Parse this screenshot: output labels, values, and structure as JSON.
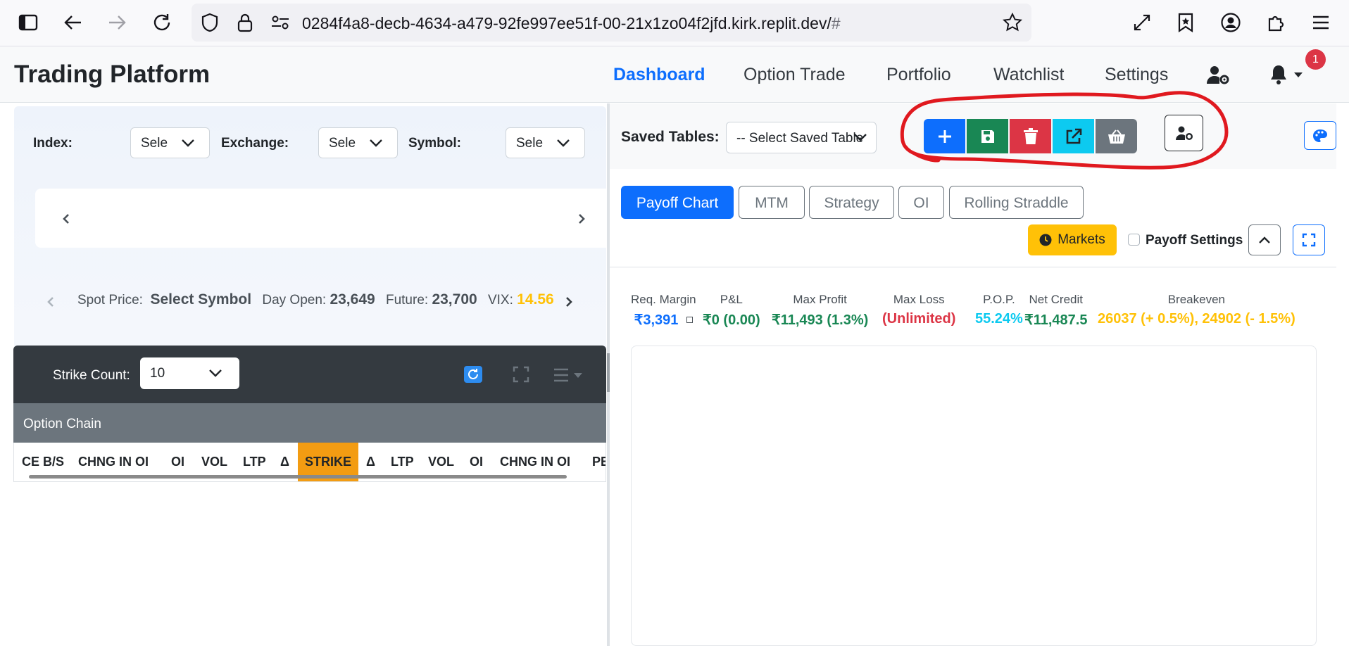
{
  "browser": {
    "url_main": "0284f4a8-decb-4634-a479-92fe997ee51f-00-21x1zo04f2jfd.kirk.replit.dev/",
    "url_hash": "#"
  },
  "navbar": {
    "brand": "Trading Platform",
    "links": [
      {
        "label": "Dashboard",
        "active": true
      },
      {
        "label": "Option Trade"
      },
      {
        "label": "Portfolio"
      },
      {
        "label": "Watchlist"
      },
      {
        "label": "Settings"
      }
    ],
    "notification_count": "1"
  },
  "filters": {
    "index_label": "Index:",
    "index_value": "Sele",
    "exchange_label": "Exchange:",
    "exchange_value": "Sele",
    "symbol_label": "Symbol:",
    "symbol_value": "Sele"
  },
  "spot": {
    "spot_label": "Spot Price:",
    "spot_value": "Select Symbol",
    "day_open_label": "Day Open:",
    "day_open_value": "23,649",
    "future_label": "Future:",
    "future_value": "23,700",
    "vix_label": "VIX:",
    "vix_value": "14.56"
  },
  "chain_controls": {
    "strike_count_label": "Strike Count:",
    "strike_count_value": "10"
  },
  "option_chain": {
    "title": "Option Chain",
    "columns": [
      "CE B/S",
      "CHNG IN OI",
      "OI",
      "VOL",
      "LTP",
      "Δ",
      "STRIKE",
      "Δ",
      "LTP",
      "VOL",
      "OI",
      "CHNG IN OI",
      "PE"
    ]
  },
  "saved_tables": {
    "label": "Saved Tables:",
    "select_value": "-- Select Saved Table"
  },
  "tabs": [
    "Payoff Chart",
    "MTM",
    "Strategy",
    "OI",
    "Rolling Straddle"
  ],
  "controls": {
    "markets_label": "Markets",
    "payoff_settings_label": "Payoff Settings"
  },
  "metrics": [
    {
      "label": "Req. Margin",
      "value": "₹3,391",
      "color": "#0d6efd"
    },
    {
      "label": "P&L",
      "value": "₹0 (0.00)",
      "color": "#198754"
    },
    {
      "label": "Max Profit",
      "value": "₹11,493 (1.3%)",
      "color": "#198754"
    },
    {
      "label": "Max Loss",
      "value": "(Unlimited)",
      "color": "#dc3545"
    },
    {
      "label": "P.O.P.",
      "value": "55.24%",
      "color": "#0dcaf0"
    },
    {
      "label": "Net Credit",
      "value": "₹11,487.5",
      "color": "#198754"
    },
    {
      "label": "Breakeven",
      "value": "26037 (+ 0.5%), 24902 (- 1.5%)",
      "color": "#ffc107"
    }
  ],
  "colors": {
    "primary": "#0d6efd",
    "success": "#198754",
    "danger": "#dc3545",
    "info": "#0dcaf0",
    "secondary": "#6c757d",
    "warning": "#ffc107",
    "strike_highlight": "#f39c12",
    "annotation": "#e0191f"
  }
}
